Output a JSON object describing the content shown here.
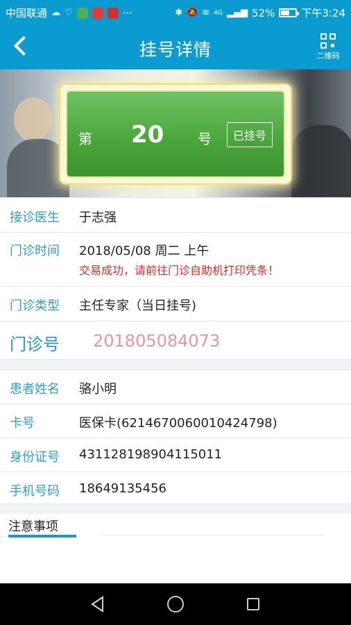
{
  "status_bar": {
    "carrier": "中国联通",
    "more": "···",
    "network": "4G",
    "battery_percent": "52%",
    "battery_level": 0.52,
    "time": "下午3:24"
  },
  "app_bar": {
    "title": "挂号详情",
    "qr_label": "二维码"
  },
  "ticket": {
    "prefix": "第",
    "number": "20",
    "suffix": "号",
    "status": "已挂号"
  },
  "appointment": {
    "doctor_label": "接诊医生",
    "doctor": "于志强",
    "time_label": "门诊时间",
    "time": "2018/05/08 周二 上午",
    "notice": "交易成功，请前往门诊自助机打印凭条！",
    "type_label": "门诊类型",
    "type": "主任专家（当日挂号)",
    "clinic_no_label": "门诊号",
    "clinic_no": "201805084073"
  },
  "patient": {
    "name_label": "患者姓名",
    "name": "骆小明",
    "card_label": "卡号",
    "card": "医保卡(6214670060010424798)",
    "id_label": "身份证号",
    "id": "431128198904115011",
    "phone_label": "手机号码",
    "phone": "18649135456"
  },
  "notes": {
    "tab_label": "注意事项"
  },
  "colors": {
    "primary": "#0a9bd0",
    "label": "#2a9fd0",
    "alert": "#e8271e",
    "clinic_number": "#f09397",
    "ticket_green": "#49a53a"
  }
}
